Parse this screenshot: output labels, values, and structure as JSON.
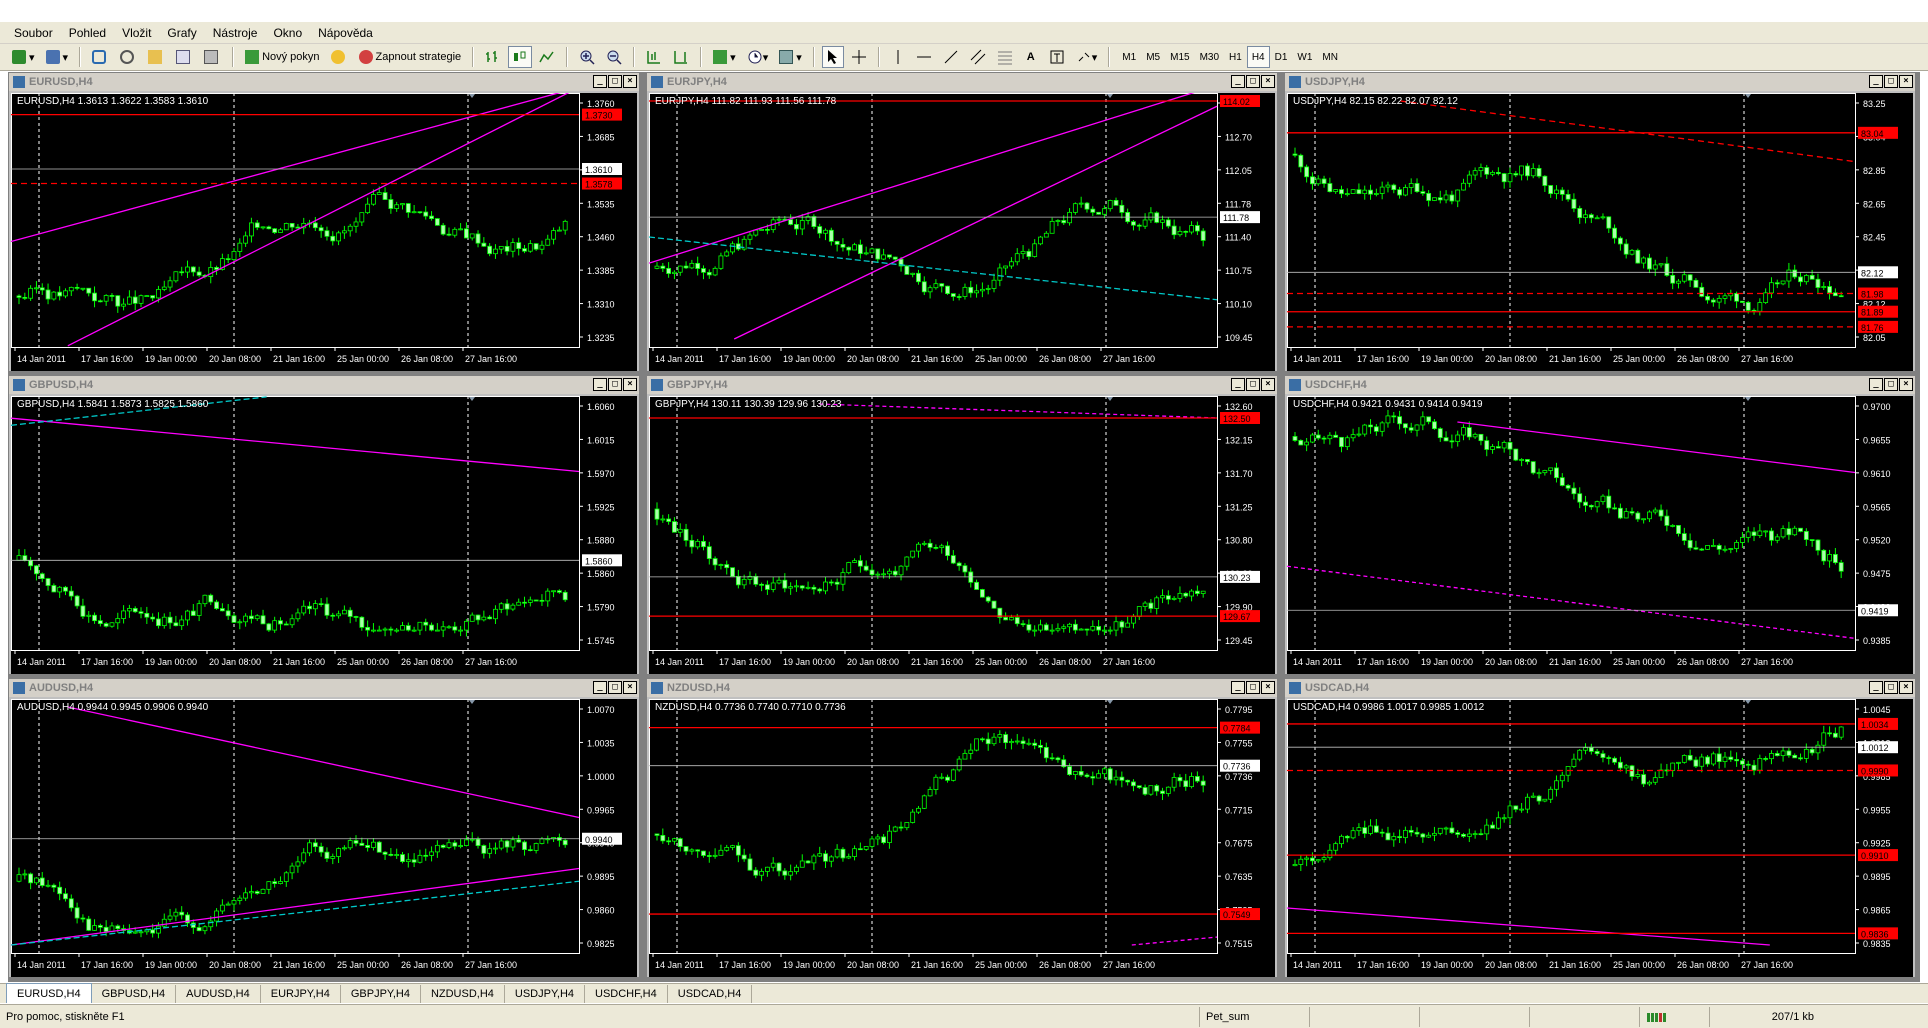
{
  "menu": [
    {
      "label": "Soubor"
    },
    {
      "label": "Pohled"
    },
    {
      "label": "Vložit"
    },
    {
      "label": "Grafy"
    },
    {
      "label": "Nástroje"
    },
    {
      "label": "Okno"
    },
    {
      "label": "Nápověda"
    }
  ],
  "toolbar": {
    "new_order": "Nový pokyn",
    "start_strategy": "Zapnout strategie",
    "draw_text": "A",
    "timeframes": [
      "M1",
      "M5",
      "M15",
      "M30",
      "H1",
      "H4",
      "D1",
      "W1",
      "MN"
    ],
    "active_timeframe": "H4"
  },
  "colors": {
    "bg": "#000000",
    "candle": "#aaffaa",
    "wick": "#00ff00",
    "trend": "#ff00ff",
    "level": "#ff0000",
    "cyan": "#00c8c8",
    "grid": "#ffffff",
    "current": "#c0c0c0"
  },
  "time_labels": [
    "14 Jan 2011",
    "17 Jan 16:00",
    "19 Jan 00:00",
    "20 Jan 08:00",
    "21 Jan 16:00",
    "25 Jan 00:00",
    "26 Jan 08:00",
    "27 Jan 16:00"
  ],
  "charts": [
    {
      "title": "EURUSD,H4",
      "ohlc": "EURUSD,H4  1.3613 1.3622 1.3583 1.3610",
      "active": false,
      "y_labels": [
        "1.3760",
        "1.3685",
        "1.3610",
        "1.3535",
        "1.3460",
        "1.3385",
        "1.3310",
        "1.3235"
      ],
      "ymin": 1.3235,
      "ymax": 1.376,
      "current": "1.3610",
      "red_labels": [
        {
          "text": "1.3730",
          "value": 1.373
        },
        {
          "text": "1.3578",
          "value": 1.3578
        }
      ],
      "current_value": 1.361,
      "start": 1.333,
      "end": 1.361,
      "trend": 1,
      "trendlines": [
        [
          0.0,
          1.345,
          1.0,
          1.379
        ],
        [
          0.1,
          1.322,
          1.0,
          1.379
        ]
      ],
      "h_red": [
        1.373
      ],
      "h_red_dashed": [
        1.3578
      ],
      "seed": 3
    },
    {
      "title": "EURJPY,H4",
      "ohlc": "EURJPY,H4  111.82 111.93 111.56 111.78",
      "active": false,
      "y_labels": [
        "113.35",
        "112.70",
        "112.05",
        "111.78",
        "111.40",
        "110.75",
        "110.10",
        "109.45"
      ],
      "ymin": 109.45,
      "ymax": 114.0,
      "current": "111.78",
      "red_labels": [
        {
          "text": "114.02",
          "value": 114.0
        }
      ],
      "current_value": 111.78,
      "start": 110.8,
      "end": 111.78,
      "trend": 1,
      "trendlines": [
        [
          0.0,
          110.9,
          1.0,
          114.3
        ],
        [
          0.15,
          109.45,
          1.0,
          113.9
        ]
      ],
      "cyanlines": [
        [
          0.0,
          111.4,
          1.0,
          110.2
        ]
      ],
      "h_red": [
        114.0
      ],
      "seed": 7
    },
    {
      "title": "USDJPY,H4",
      "ohlc": "USDJPY,H4  82.15 82.22 82.07 82.12",
      "active": false,
      "y_labels": [
        "83.25",
        "83.04",
        "82.85",
        "82.65",
        "82.45",
        "82.25",
        "82.12",
        "82.05"
      ],
      "ymin": 81.68,
      "ymax": 83.25,
      "current": "82.12",
      "red_labels": [
        {
          "text": "83.04",
          "value": 83.04
        },
        {
          "text": "81.98",
          "value": 81.98
        },
        {
          "text": "81.89",
          "value": 81.86
        },
        {
          "text": "81.76",
          "value": 81.76
        }
      ],
      "current_value": 82.12,
      "start": 82.9,
      "end": 82.12,
      "trend": -1,
      "reddashlines": [
        [
          0.2,
          83.25,
          1.0,
          82.85
        ]
      ],
      "h_red": [
        83.04,
        81.86
      ],
      "h_red_dashed": [
        81.98,
        81.76
      ],
      "seed": 11
    },
    {
      "title": "GBPUSD,H4",
      "ohlc": "GBPUSD,H4  1.5841 1.5873 1.5825 1.5860",
      "active": false,
      "y_labels": [
        "1.6060",
        "1.6015",
        "1.5970",
        "1.5925",
        "1.5880",
        "1.5860",
        "1.5790",
        "1.5745"
      ],
      "ymin": 1.5745,
      "ymax": 1.608,
      "current": "1.5860",
      "red_labels": [],
      "current_value": 1.586,
      "start": 1.586,
      "end": 1.586,
      "trend": 0,
      "trendlines": [
        [
          0.0,
          1.606,
          1.0,
          1.5985
        ]
      ],
      "cyanlines": [
        [
          0.0,
          1.605,
          0.45,
          1.609
        ]
      ],
      "h_red": [],
      "seed": 17
    },
    {
      "title": "GBPJPY,H4",
      "ohlc": "GBPJPY,H4  130.11 130.39 129.96 130.23",
      "active": false,
      "y_labels": [
        "132.60",
        "132.15",
        "131.70",
        "131.25",
        "130.80",
        "130.23",
        "129.90",
        "129.45"
      ],
      "ymin": 129.3,
      "ymax": 132.7,
      "current": "130.23",
      "red_labels": [
        {
          "text": "132.50",
          "value": 132.5
        },
        {
          "text": "129.67",
          "value": 129.67
        }
      ],
      "current_value": 130.23,
      "start": 131.2,
      "end": 130.23,
      "trend": -1,
      "dashmag": [
        [
          0.3,
          132.7,
          1.0,
          132.5
        ]
      ],
      "h_red": [
        132.5,
        129.67
      ],
      "seed": 23
    },
    {
      "title": "USDCHF,H4",
      "ohlc": "USDCHF,H4  0.9421 0.9431 0.9414 0.9419",
      "active": false,
      "y_labels": [
        "0.9700",
        "0.9655",
        "0.9610",
        "0.9565",
        "0.9520",
        "0.9475",
        "0.9430",
        "0.9385"
      ],
      "ymin": 0.9375,
      "ymax": 0.9705,
      "current": "0.9419",
      "red_labels": [],
      "current_value": 0.9419,
      "start": 0.966,
      "end": 0.9419,
      "trend": -1,
      "trendlines": [
        [
          0.3,
          0.968,
          1.0,
          0.961
        ]
      ],
      "dashmag": [
        [
          0.0,
          0.948,
          1.0,
          0.938
        ]
      ],
      "h_red": [],
      "seed": 31
    },
    {
      "title": "AUDUSD,H4",
      "ohlc": "AUDUSD,H4  0.9944 0.9945 0.9906 0.9940",
      "active": false,
      "y_labels": [
        "1.0070",
        "1.0035",
        "1.0000",
        "0.9965",
        "0.9940",
        "0.9895",
        "0.9860",
        "0.9825"
      ],
      "ymin": 0.9815,
      "ymax": 1.0095,
      "current": "0.9940",
      "red_labels": [],
      "current_value": 0.994,
      "start": 0.989,
      "end": 0.994,
      "trend": 0,
      "trendlines": [
        [
          0.1,
          1.0095,
          1.0,
          0.9965
        ],
        [
          0.0,
          0.9815,
          1.0,
          0.9905
        ]
      ],
      "cyanlines": [
        [
          0.0,
          0.9815,
          1.0,
          0.989
        ]
      ],
      "h_red": [],
      "seed": 41
    },
    {
      "title": "NZDUSD,H4",
      "ohlc": "NZDUSD,H4  0.7736 0.7740 0.7710 0.7736",
      "active": false,
      "y_labels": [
        "0.7795",
        "0.7755",
        "0.7736",
        "0.7715",
        "0.7675",
        "0.7635",
        "0.7595",
        "0.7515"
      ],
      "ymin": 0.751,
      "ymax": 0.781,
      "current": "0.7736",
      "red_labels": [
        {
          "text": "0.7784",
          "value": 0.7784
        },
        {
          "text": "0.7549",
          "value": 0.7549
        }
      ],
      "current_value": 0.7736,
      "start": 0.765,
      "end": 0.7736,
      "trend": 0,
      "dashmag": [
        [
          0.85,
          0.751,
          1.0,
          0.752
        ]
      ],
      "h_red": [
        0.7784,
        0.7549
      ],
      "seed": 53
    },
    {
      "title": "USDCAD,H4",
      "ohlc": "USDCAD,H4  0.9986 1.0017 0.9985 1.0012",
      "active": false,
      "y_labels": [
        "1.0045",
        "1.0012",
        "0.9985",
        "0.9955",
        "0.9925",
        "0.9895",
        "0.9865",
        "0.9835"
      ],
      "ymin": 0.9825,
      "ymax": 1.005,
      "current": "1.0012",
      "red_labels": [
        {
          "text": "1.0034",
          "value": 1.0034
        },
        {
          "text": "0.9990",
          "value": 0.999
        },
        {
          "text": "0.9910",
          "value": 0.991
        },
        {
          "text": "0.9836",
          "value": 0.9836
        }
      ],
      "current_value": 1.0012,
      "start": 0.99,
      "end": 1.0012,
      "trend": 1,
      "trendlines": [
        [
          0.0,
          0.986,
          0.85,
          0.9825
        ]
      ],
      "h_red": [
        1.0034,
        0.991,
        0.9836
      ],
      "h_red_dashed": [
        0.999
      ],
      "seed": 61
    }
  ],
  "tabs": [
    {
      "label": "EURUSD,H4",
      "active": true
    },
    {
      "label": "GBPUSD,H4",
      "active": false
    },
    {
      "label": "AUDUSD,H4",
      "active": false
    },
    {
      "label": "EURJPY,H4",
      "active": false
    },
    {
      "label": "GBPJPY,H4",
      "active": false
    },
    {
      "label": "NZDUSD,H4",
      "active": false
    },
    {
      "label": "USDJPY,H4",
      "active": false
    },
    {
      "label": "USDCHF,H4",
      "active": false
    },
    {
      "label": "USDCAD,H4",
      "active": false
    }
  ],
  "status": {
    "help": "Pro pomoc, stiskněte F1",
    "profile": "Pet_sum",
    "traffic": "207/1 kb"
  }
}
